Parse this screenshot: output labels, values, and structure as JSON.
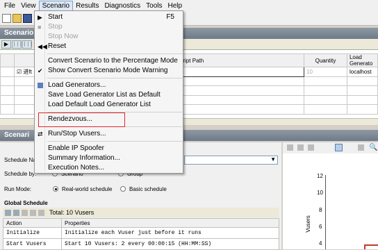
{
  "menubar": [
    "File",
    "View",
    "Scenario",
    "Results",
    "Diagnostics",
    "Tools",
    "Help"
  ],
  "panels": {
    "scenario_groups": "Scenario",
    "scenario_schedule": "Scenari"
  },
  "scenario_grid": {
    "headers": {
      "script_path": "ript Path",
      "quantity": "Quantity",
      "load_generators": "Load Generato"
    },
    "row1": {
      "name": "进ft",
      "quantity": "10",
      "lg": "localhost"
    }
  },
  "schedule": {
    "name_label": "Schedule Na",
    "by_label": "Schedule by:",
    "scenario_opt": "Scenario",
    "group_opt": "Group",
    "run_mode_label": "Run Mode:",
    "real_world": "Real-world schedule",
    "basic": "Basic schedule"
  },
  "global_schedule": {
    "title": "Global Schedule",
    "total": "Total: 10 Vusers",
    "headers": [
      "Action",
      "Properties"
    ],
    "rows": [
      {
        "action": "Initialize",
        "props": "Initialize each Vuser just before it runs"
      },
      {
        "action": "Start  Vusers",
        "props": "Start 10 Vusers: 2 every 00:00:15 (HH:MM:SS)"
      }
    ]
  },
  "graph": {
    "ylabel": "Vusers",
    "ticks": [
      "12",
      "10",
      "8",
      "6",
      "4"
    ]
  },
  "scenario_menu": {
    "start": "Start",
    "start_shortcut": "F5",
    "stop": "Stop",
    "stop_now": "Stop Now",
    "reset": "Reset",
    "convert": "Convert Scenario to the Percentage Mode",
    "show_warning": "Show Convert Scenario Mode Warning",
    "load_generators": "Load Generators...",
    "save_lg": "Save Load Generator List as Default",
    "load_default_lg": "Load Default Load Generator List",
    "rendezvous": "Rendezvous...",
    "run_stop": "Run/Stop Vusers...",
    "ip_spoofer": "Enable IP Spoofer",
    "summary": "Summary Information...",
    "exec_notes": "Execution Notes..."
  }
}
